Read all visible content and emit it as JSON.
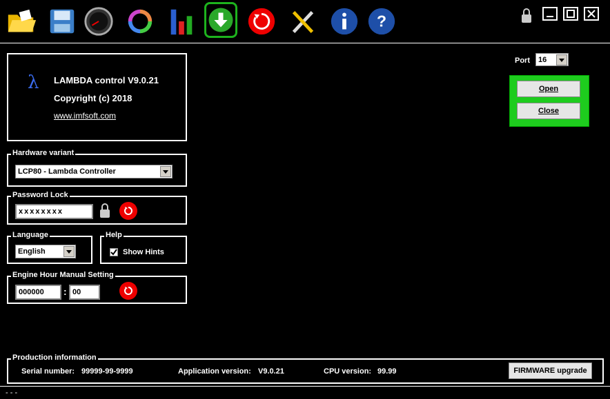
{
  "toolbar": {
    "buttons": [
      {
        "name": "open-folder-icon"
      },
      {
        "name": "save-disk-icon"
      },
      {
        "name": "gauge-icon"
      },
      {
        "name": "cycle-arrows-icon"
      },
      {
        "name": "bar-chart-icon"
      },
      {
        "name": "download-arrow-icon"
      },
      {
        "name": "reset-icon"
      },
      {
        "name": "tools-icon"
      },
      {
        "name": "info-icon"
      },
      {
        "name": "help-icon"
      }
    ]
  },
  "about": {
    "symbol": "λ",
    "title": "LAMBDA control  V9.0.21",
    "copyright": "Copyright (c) 2018",
    "website": "www.imfsoft.com"
  },
  "port": {
    "label": "Port",
    "value": "16",
    "open_label": "Open",
    "close_label": "Close"
  },
  "hardware": {
    "title": "Hardware variant",
    "value": "LCP80 - Lambda Controller"
  },
  "password": {
    "title": "Password Lock",
    "value": "xxxxxxxx"
  },
  "language": {
    "title": "Language",
    "value": "English"
  },
  "help": {
    "title": "Help",
    "show_hints_label": "Show Hints",
    "show_hints_checked": true
  },
  "engine": {
    "title": "Engine Hour Manual Setting",
    "hours": "000000",
    "separator": ":",
    "minutes": "00"
  },
  "production": {
    "title": "Production information",
    "serial_label": "Serial number:",
    "serial_value": "99999-99-9999",
    "app_label": "Application version:",
    "app_value": "V9.0.21",
    "cpu_label": "CPU version:",
    "cpu_value": "99.99",
    "firmware_label": "FIRMWARE upgrade"
  },
  "status": {
    "text": "- - -"
  },
  "colors": {
    "accent_green": "#1db31d",
    "reset_red": "#e00000"
  }
}
